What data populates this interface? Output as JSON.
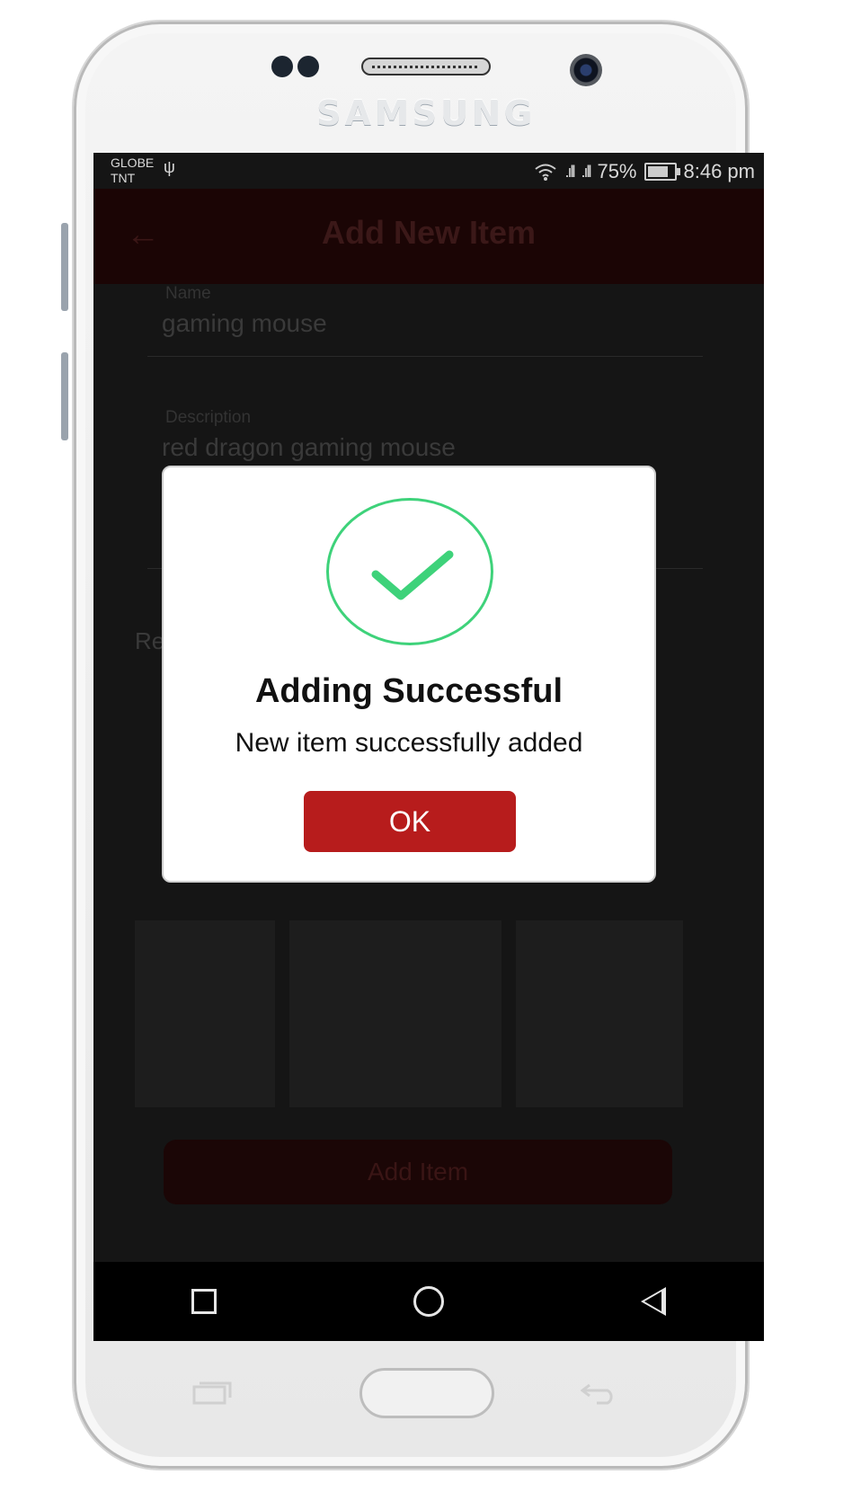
{
  "device": {
    "brand": "SAMSUNG"
  },
  "status_bar": {
    "carrier_line1": "GLOBE",
    "carrier_line2": "TNT",
    "battery": "75%",
    "time": "8:46 pm"
  },
  "app_bar": {
    "title": "Add New Item"
  },
  "form": {
    "name_label": "Name",
    "name_value": "gaming mouse",
    "description_label": "Description",
    "description_value": "red dragon gaming mouse",
    "partial_label": "Re"
  },
  "add_button": {
    "label": "Add Item"
  },
  "dialog": {
    "icon": "check-icon",
    "title": "Adding Successful",
    "message": "New item successfully added",
    "ok_label": "OK"
  },
  "colors": {
    "accent": "#b71c1c",
    "success": "#3ed27a"
  }
}
